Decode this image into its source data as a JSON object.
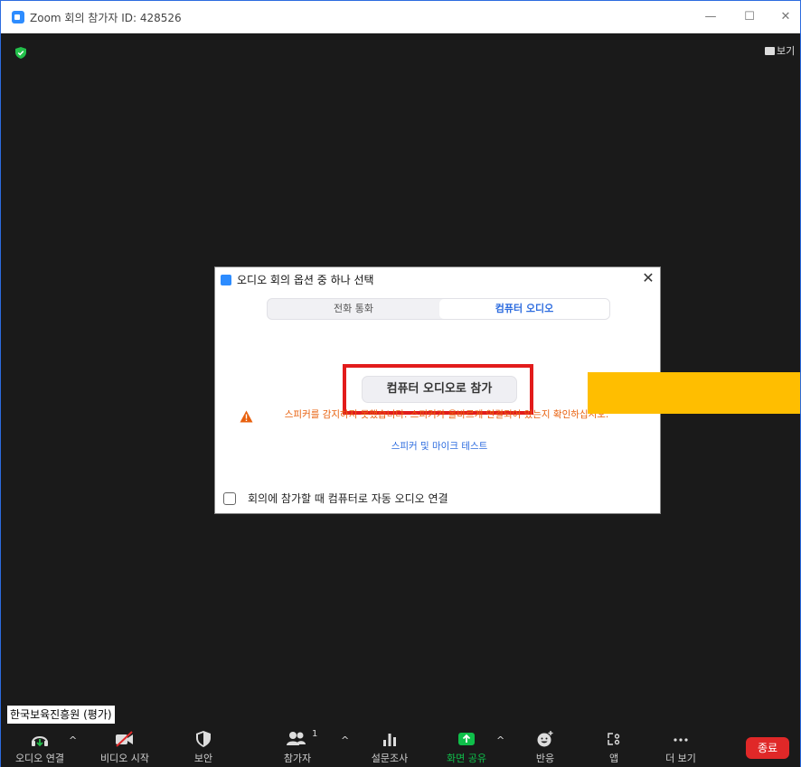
{
  "window": {
    "title": "Zoom 회의 참가자 ID: 428526",
    "minimize": "—",
    "maximize": "☐",
    "close": "✕"
  },
  "video": {
    "view_label": "보기",
    "participant_name": "한국보육진흥원 (평가)"
  },
  "dialog": {
    "title": "오디오 회의 옵션 중 하나 선택",
    "close": "✕",
    "tabs": [
      "전화 통화",
      "컴퓨터 오디오"
    ],
    "join_button": "컴퓨터 오디오로 참가",
    "warning": "스피커를 감지하지 못했습니다. 스피커가 올바르게 연결되어 있는지 확인하십시오.",
    "test_link": "스피커 및 마이크 테스트",
    "auto_connect_label": "회의에 참가할 때 컴퓨터로 자동 오디오 연결",
    "auto_connect_checked": false
  },
  "toolbar": {
    "audio": "오디오 연결",
    "video": "비디오 시작",
    "security": "보안",
    "participants": "참가자",
    "participants_count": "1",
    "polls": "설문조사",
    "share": "화면 공유",
    "reactions": "반응",
    "apps": "앱",
    "more": "더 보기",
    "end": "종료",
    "caret": "^"
  },
  "colors": {
    "accent": "#2d8cff",
    "share_green": "#0fbf4a",
    "warning": "#e8600d",
    "highlight_red": "#e21b1b",
    "annotation_yellow": "#ffbe00",
    "end_red": "#e02828"
  }
}
